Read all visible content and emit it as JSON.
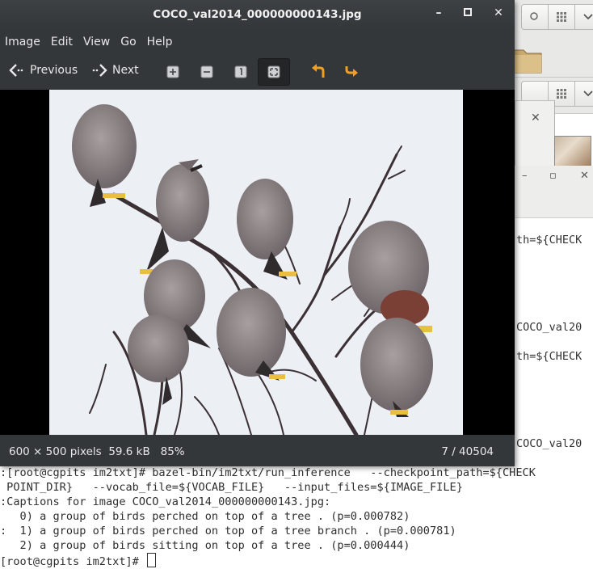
{
  "viewer": {
    "title": "COCO_val2014_000000000143.jpg",
    "menu": [
      "Image",
      "Edit",
      "View",
      "Go",
      "Help"
    ],
    "toolbar": {
      "previous_label": "Previous",
      "next_label": "Next",
      "buttons": [
        "zoom-in-icon",
        "zoom-out-icon",
        "original-size-icon",
        "best-fit-icon",
        "rotate-left-icon",
        "rotate-right-icon"
      ]
    },
    "status": {
      "dimensions": "600 × 500 pixels",
      "size": "59.6 kB",
      "zoom": "85%",
      "position": "7 / 40504"
    }
  },
  "background_editor": {
    "lines": [
      "th=${CHECK",
      "COCO_val20",
      "th=${CHECK",
      "COCO_val20"
    ]
  },
  "terminal": {
    "lines": [
      ":[root@cgpits im2txt]# bazel-bin/im2txt/run_inference   --checkpoint_path=${CHECK",
      " POINT_DIR}   --vocab_file=${VOCAB_FILE}   --input_files=${IMAGE_FILE}",
      ":Captions for image COCO_val2014_000000000143.jpg:",
      "   0) a group of birds perched on top of a tree . (p=0.000782)",
      ":  1) a group of birds perched on top of a tree branch . (p=0.000781)",
      "   2) a group of birds sitting on top of a tree . (p=0.000444)"
    ],
    "prompt": "[root@cgpits im2txt]# "
  },
  "colors": {
    "viewer_chrome": "#33373a",
    "accent_orange": "#f0a020",
    "photo_sky": "#eceff4"
  }
}
